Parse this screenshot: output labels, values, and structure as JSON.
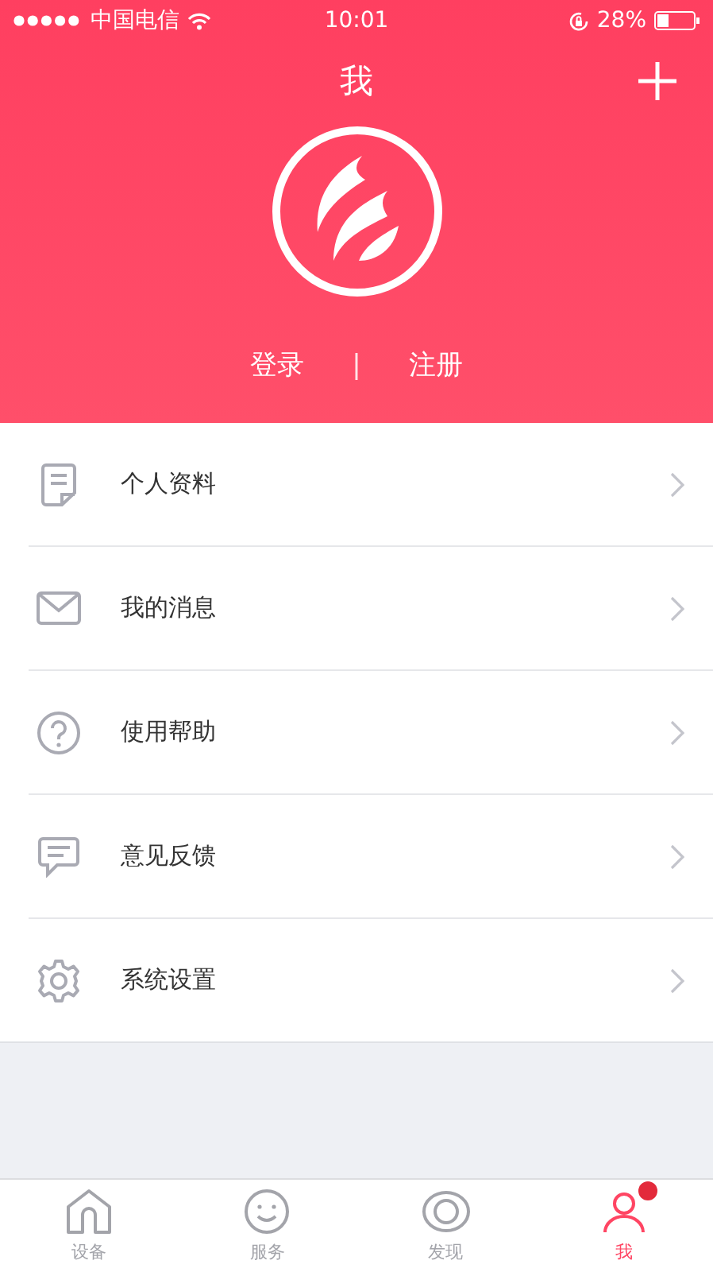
{
  "status_bar": {
    "carrier": "中国电信",
    "time": "10:01",
    "battery": "28%"
  },
  "header": {
    "title": "我",
    "login": "登录",
    "divider": "|",
    "register": "注册"
  },
  "menu": [
    {
      "kind": "profile",
      "label": "个人资料"
    },
    {
      "kind": "messages",
      "label": "我的消息"
    },
    {
      "kind": "help",
      "label": "使用帮助"
    },
    {
      "kind": "feedback",
      "label": "意见反馈"
    },
    {
      "kind": "settings",
      "label": "系统设置"
    }
  ],
  "tabs": [
    {
      "kind": "home",
      "label": "设备",
      "selected": false,
      "badge": false
    },
    {
      "kind": "service",
      "label": "服务",
      "selected": false,
      "badge": false
    },
    {
      "kind": "discover",
      "label": "发现",
      "selected": false,
      "badge": false
    },
    {
      "kind": "me",
      "label": "我",
      "selected": true,
      "badge": true
    }
  ]
}
